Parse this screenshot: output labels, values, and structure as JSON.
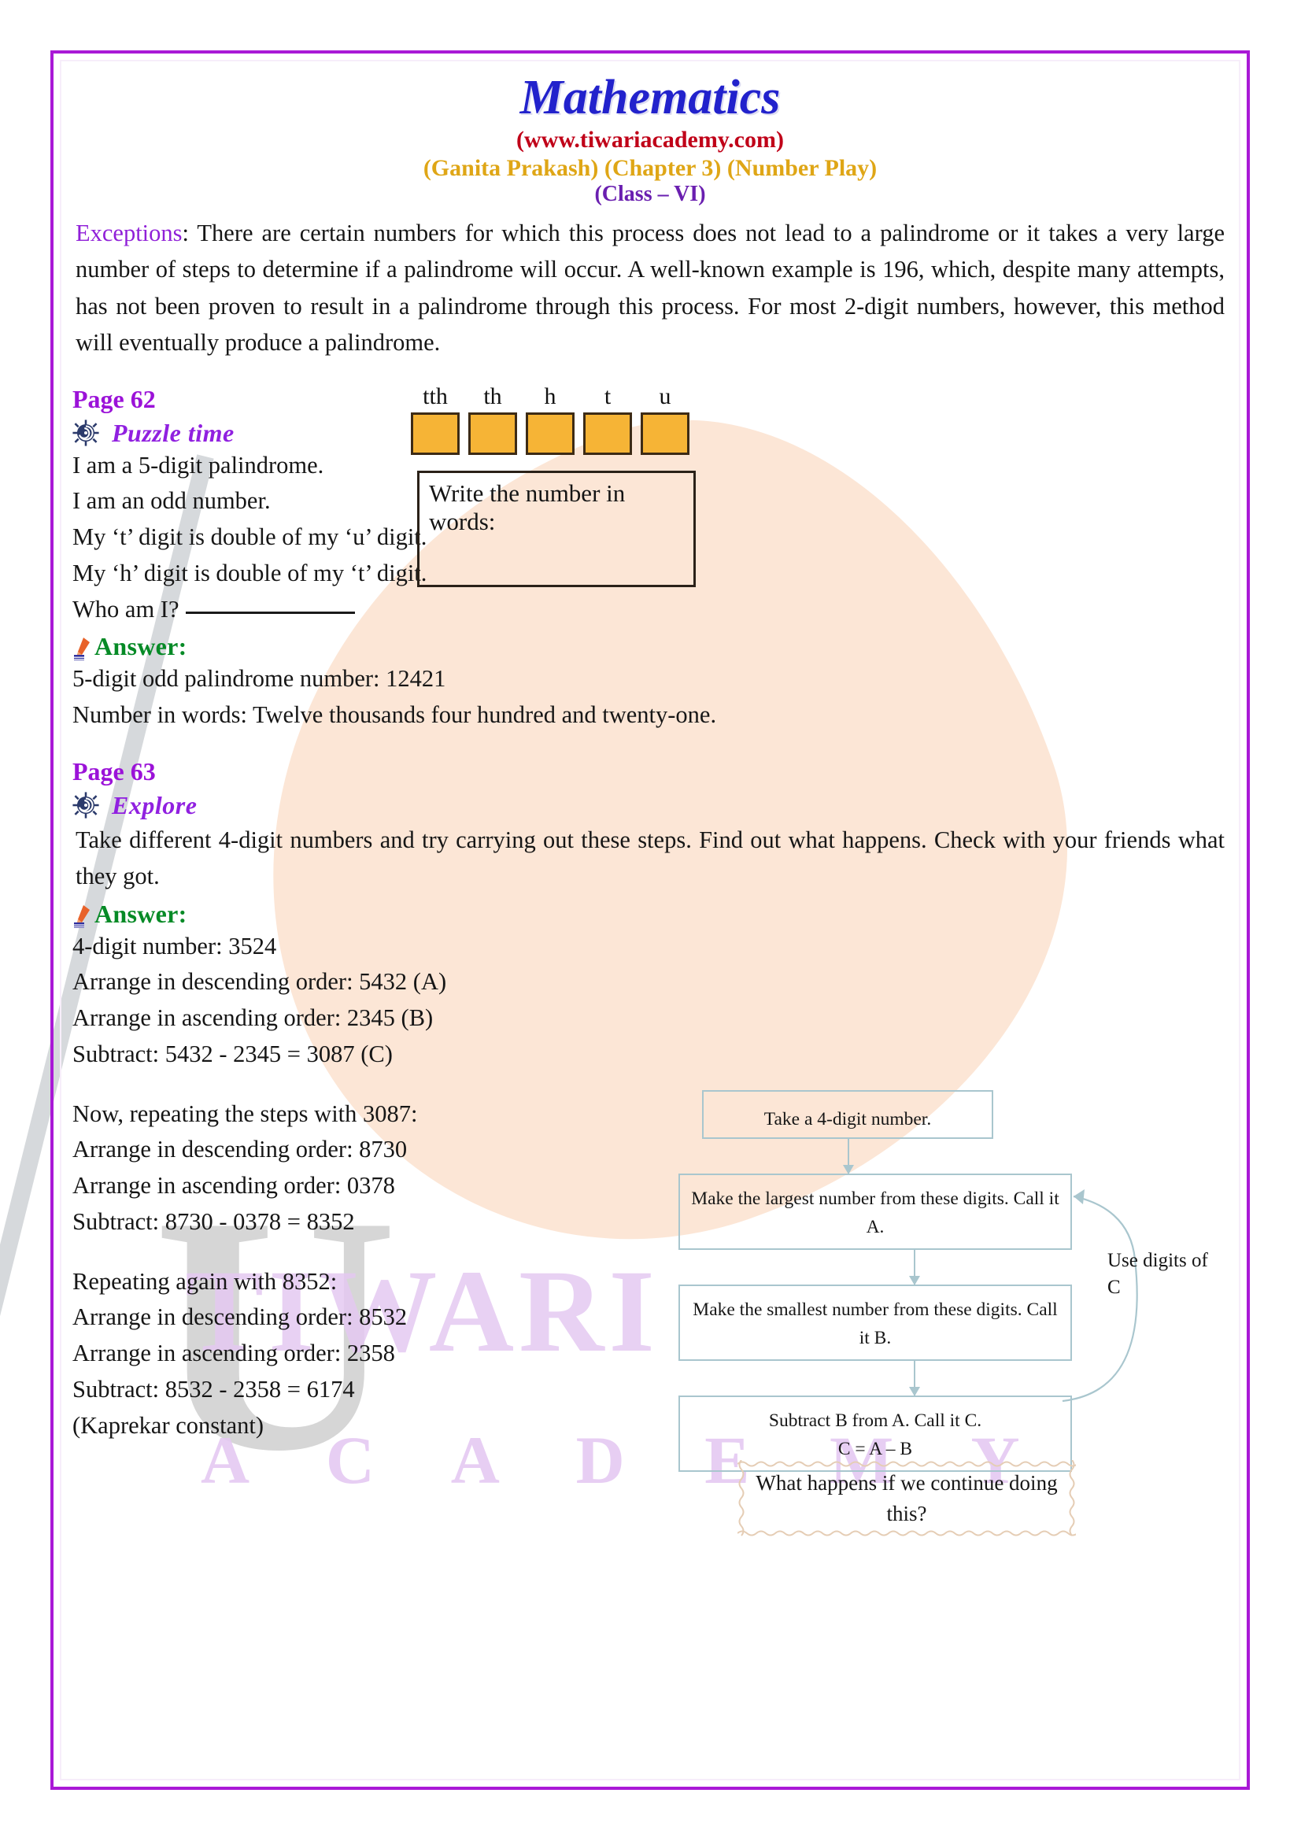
{
  "header": {
    "title": "Mathematics",
    "url": "(www.tiwariacademy.com)",
    "chapter": "(Ganita Prakash) (Chapter 3) (Number Play)",
    "class": "(Class – VI)"
  },
  "exceptions": {
    "lead": "Exceptions",
    "body": ": There are certain numbers for which this process does not lead to a palindrome or it takes a very large number of steps to determine if a palindrome will occur. A well-known example is 196, which, despite many attempts, has not been proven to result in a palindrome through this process. For most 2-digit numbers, however, this method will eventually produce a palindrome."
  },
  "page62": {
    "label": "Page 62",
    "heading": "Puzzle time",
    "icon": "gear-spiral-icon",
    "clues": [
      "I am a 5-digit palindrome.",
      "I am an odd number.",
      "My ‘t’ digit is double of my ‘u’ digit.",
      "My ‘h’ digit is double of my ‘t’ digit."
    ],
    "who_am_i": "Who am I?",
    "answer_label": "Answer:",
    "answer_icon": "pen-nib-icon",
    "answer_lines": [
      "5-digit odd palindrome number: 12421",
      "Number in words: Twelve thousands four hundred and twenty-one."
    ],
    "place_values": [
      "tth",
      "th",
      "h",
      "t",
      "u"
    ],
    "place_value_digits": [
      "",
      "",
      "",
      "",
      ""
    ],
    "words_box_prompt": "Write the number in words:",
    "words_box_value": "",
    "box_fill_color": "#f6b436",
    "box_border_color": "#3d2b15"
  },
  "page63": {
    "label": "Page 63",
    "heading": "Explore",
    "icon": "gear-spiral-icon",
    "prompt": "Take different 4-digit numbers and try carrying out these steps. Find out what happens. Check with your friends what they got.",
    "answer_label": "Answer:",
    "answer_icon": "pen-nib-icon",
    "answer_lines": [
      "4-digit number: 3524",
      "Arrange in descending order: 5432 (A)",
      "Arrange in ascending order: 2345 (B)",
      "Subtract: 5432 - 2345 = 3087 (C)",
      "",
      "Now, repeating the steps with 3087:",
      "Arrange in descending order: 8730",
      "Arrange in ascending order: 0378",
      "Subtract: 8730 - 0378 = 8352",
      "",
      "Repeating again with 8352:",
      "Arrange in descending order: 8532",
      "Arrange in ascending order: 2358",
      "Subtract: 8532 - 2358 = 6174",
      "(Kaprekar constant)"
    ]
  },
  "flowchart": {
    "box1": "Take a 4-digit number.",
    "box2": "Make the largest number from these digits. Call it A.",
    "box3": "Make the smallest number from these digits. Call it B.",
    "box4_line1": "Subtract B from A. Call it C.",
    "box4_line2": "C = A – B",
    "loop_label": "Use digits of C",
    "question_box": "What happens if we continue doing this?",
    "border_color": "#a9c6ce",
    "question_border_color": "#e5cdb5"
  },
  "watermark": {
    "brand_top": "TIWARI",
    "brand_bottom": "A C A D E M Y",
    "mark_letter": "U"
  },
  "theme": {
    "frame_color": "#a919d6",
    "title_color": "#2222cc",
    "url_color": "#c00018",
    "chapter_color": "#dfa616",
    "class_color": "#6a1fb0",
    "page_label_color": "#9b12d8",
    "heading_color": "#9020e0",
    "answer_color": "#068a26",
    "leaf_color": "#fbdcc6"
  }
}
